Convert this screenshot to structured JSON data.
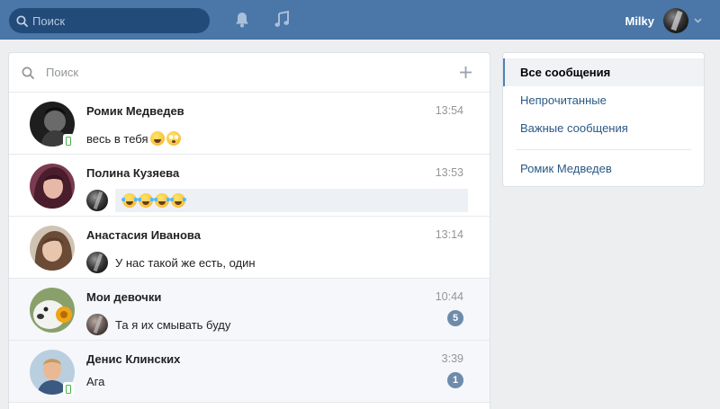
{
  "header": {
    "search_placeholder": "Поиск",
    "icons": [
      "search-icon",
      "bell-icon",
      "music-icon",
      "chevron-down-icon"
    ],
    "user_name": "Milky"
  },
  "dialogs": {
    "search_placeholder": "Поиск",
    "rows": [
      {
        "name": "Ромик Медведев",
        "time": "13:54",
        "text": "весь в тебя",
        "emoji": [
          "smirk",
          "flushed"
        ],
        "online_mobile": true,
        "outgoing": false,
        "unread": null
      },
      {
        "name": "Полина Кузяева",
        "time": "13:53",
        "text": "",
        "emoji": [
          "joy",
          "joy",
          "joy",
          "joy"
        ],
        "online_mobile": false,
        "outgoing": true,
        "unread": null
      },
      {
        "name": "Анастасия Иванова",
        "time": "13:14",
        "text": "У нас такой же есть, один",
        "emoji": [],
        "online_mobile": false,
        "outgoing": true,
        "unread": null
      },
      {
        "name": "Мои девочки",
        "time": "10:44",
        "text": "Та я их смывать буду",
        "emoji": [],
        "online_mobile": false,
        "outgoing": false,
        "unread": "5"
      },
      {
        "name": "Денис Клинских",
        "time": "3:39",
        "text": "Ага",
        "emoji": [],
        "online_mobile": true,
        "outgoing": false,
        "unread": "1"
      }
    ]
  },
  "sidebar": {
    "items": [
      {
        "label": "Все сообщения",
        "active": true
      },
      {
        "label": "Непрочитанные",
        "active": false
      },
      {
        "label": "Важные сообщения",
        "active": false
      },
      {
        "label": "Ромик Медведев",
        "active": false
      }
    ]
  },
  "colors": {
    "header_bg": "#4a76a8",
    "link": "#2a5885",
    "page_bg": "#edeef0",
    "badge": "#6f8bab",
    "online": "#4bb34b"
  }
}
